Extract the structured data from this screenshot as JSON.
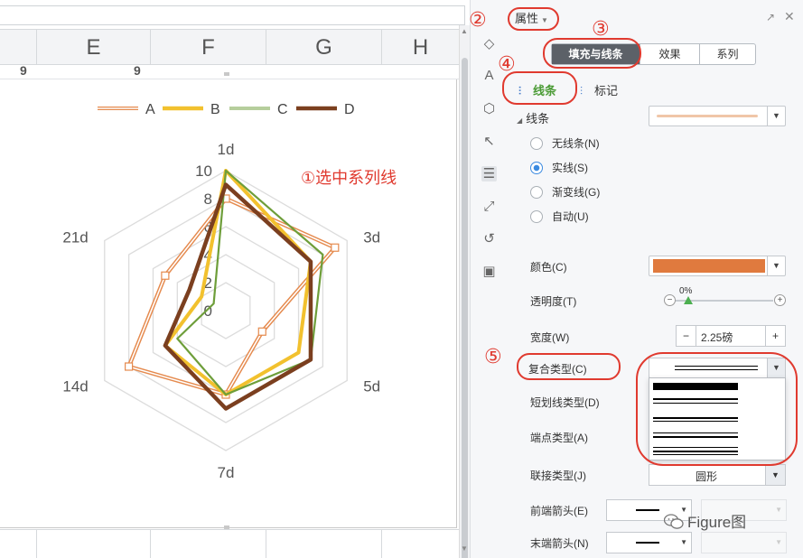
{
  "sheet": {
    "columns": [
      "E",
      "F",
      "G",
      "H"
    ],
    "row_values": [
      "9",
      "9"
    ]
  },
  "chart_data": {
    "type": "radar",
    "categories": [
      "1d",
      "3d",
      "5d",
      "7d",
      "14d",
      "21d"
    ],
    "rlim": [
      0,
      10
    ],
    "ticks": [
      "0",
      "2",
      "4",
      "6",
      "8",
      "10"
    ],
    "legend_position": "top",
    "series": [
      {
        "name": "A",
        "color": "#e58a4e",
        "style": "double-line",
        "values": [
          8,
          9,
          3,
          6,
          8,
          5
        ]
      },
      {
        "name": "B",
        "color": "#f2c12e",
        "values": [
          10,
          7,
          6,
          6,
          5,
          2
        ]
      },
      {
        "name": "C",
        "color": "#6e9e3a",
        "values": [
          10,
          8,
          7,
          6,
          4,
          1
        ]
      },
      {
        "name": "D",
        "color": "#7b3f1f",
        "values": [
          9,
          7,
          7,
          7,
          5,
          3
        ]
      }
    ]
  },
  "annotation": {
    "select_series_note": "①选中系列线",
    "num2": "②",
    "num3": "③",
    "num4": "④",
    "num5": "⑤"
  },
  "pane": {
    "properties_label": "属性",
    "tabs": [
      "填充与线条",
      "效果",
      "系列"
    ],
    "subtabs": {
      "line": "线条",
      "marker": "标记"
    },
    "line_section": "线条",
    "radio_options": [
      "无线条(N)",
      "实线(S)",
      "渐变线(G)",
      "自动(U)"
    ],
    "radio_selected": 1,
    "color_label": "颜色(C)",
    "color_value": "#e07a3e",
    "line_preview_color": "#f0c6a8",
    "transparency_label": "透明度(T)",
    "transparency_value": "0%",
    "width_label": "宽度(W)",
    "width_value": "2.25磅",
    "compound_label": "复合类型(C)",
    "dash_label": "短划线类型(D)",
    "cap_label": "端点类型(A)",
    "join_label": "联接类型(J)",
    "join_value": "圆形",
    "begin_arrow_label": "前端箭头(E)",
    "end_arrow_label": "末端箭头(N)"
  },
  "watermark": "Figure图"
}
